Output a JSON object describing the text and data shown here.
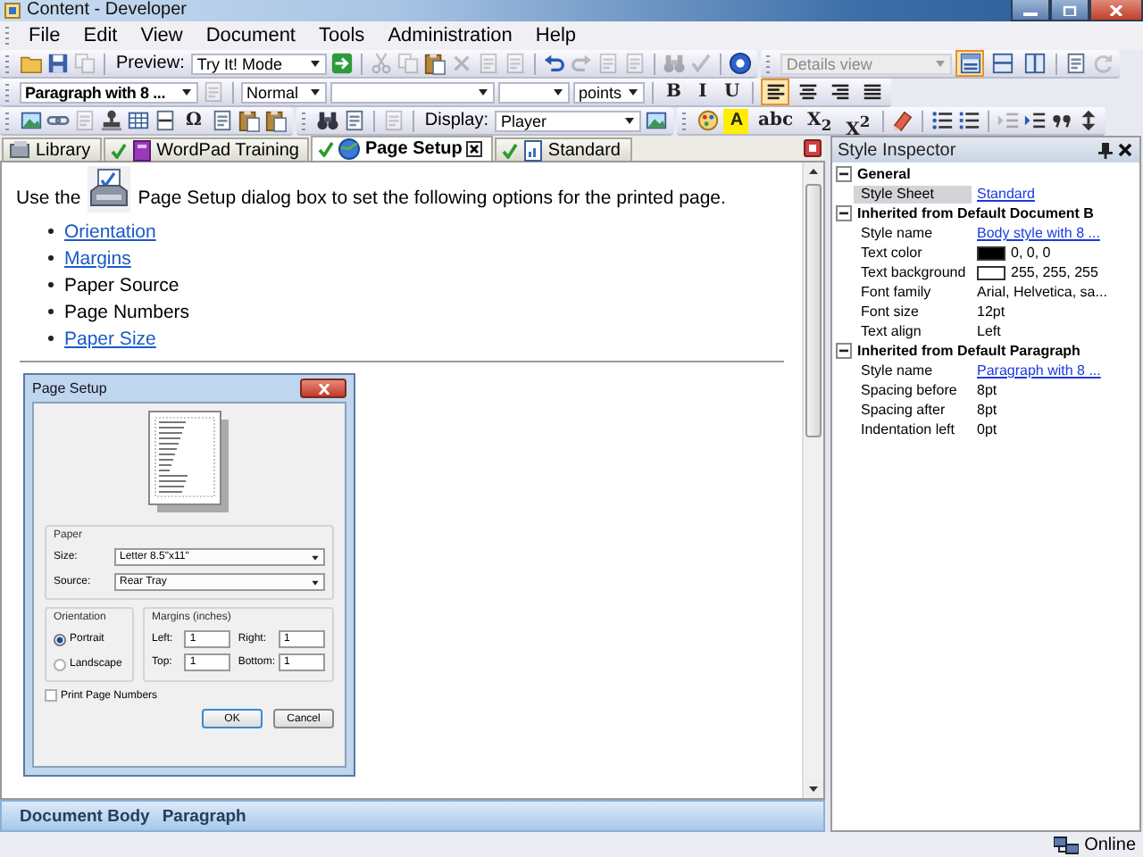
{
  "window": {
    "title": "Content - Developer"
  },
  "menu": [
    "File",
    "Edit",
    "View",
    "Document",
    "Tools",
    "Administration",
    "Help"
  ],
  "toolbars": [
    {
      "bands": [
        {
          "items": [
            {
              "kind": "icon",
              "disabled": false
            },
            {
              "kind": "icon",
              "disabled": false
            },
            {
              "kind": "icon",
              "disabled": true
            },
            {
              "kind": "separator"
            },
            {
              "kind": "label",
              "text": "Preview:"
            },
            {
              "kind": "dropdown",
              "value": "Try It! Mode",
              "disabled": false
            },
            {
              "kind": "icon",
              "disabled": false
            },
            {
              "kind": "separator"
            },
            {
              "kind": "icon",
              "disabled": true
            },
            {
              "kind": "icon",
              "disabled": true
            },
            {
              "kind": "icon",
              "disabled": false
            },
            {
              "kind": "icon",
              "disabled": true
            },
            {
              "kind": "icon",
              "disabled": true
            },
            {
              "kind": "icon",
              "disabled": true
            },
            {
              "kind": "separator"
            },
            {
              "kind": "icon",
              "disabled": false
            },
            {
              "kind": "icon",
              "disabled": true
            },
            {
              "kind": "icon",
              "disabled": true
            },
            {
              "kind": "icon",
              "disabled": true
            },
            {
              "kind": "separator"
            },
            {
              "kind": "icon",
              "disabled": true
            },
            {
              "kind": "icon",
              "disabled": true
            },
            {
              "kind": "separator"
            },
            {
              "kind": "icon",
              "disabled": false
            }
          ]
        },
        {
          "items": [
            {
              "kind": "dropdown",
              "value": "Details view",
              "disabled": true
            },
            {
              "kind": "toggle",
              "selected": true
            },
            {
              "kind": "toggle",
              "selected": false
            },
            {
              "kind": "toggle",
              "selected": false
            },
            {
              "kind": "separator"
            },
            {
              "kind": "icon",
              "disabled": false
            },
            {
              "kind": "icon",
              "disabled": true
            }
          ]
        }
      ]
    },
    {
      "bands": [
        {
          "items": [
            {
              "kind": "dropdown",
              "value": "Paragraph with 8 ...",
              "disabled": false
            },
            {
              "kind": "icon",
              "disabled": true
            },
            {
              "kind": "separator"
            },
            {
              "kind": "dropdown",
              "value": "Normal",
              "disabled": false
            },
            {
              "kind": "dropdown",
              "disabled": false
            },
            {
              "kind": "dropdown",
              "disabled": false
            },
            {
              "kind": "dropdown",
              "value": "points",
              "disabled": false
            },
            {
              "kind": "separator"
            },
            {
              "kind": "text-button",
              "text": "B",
              "selected": false
            },
            {
              "kind": "text-button",
              "text": "I",
              "selected": false
            },
            {
              "kind": "text-button",
              "text": "U",
              "selected": false
            },
            {
              "kind": "separator"
            },
            {
              "kind": "toggle",
              "selected": true
            },
            {
              "kind": "toggle",
              "selected": false
            },
            {
              "kind": "toggle",
              "selected": false
            },
            {
              "kind": "toggle",
              "selected": false
            }
          ]
        }
      ]
    },
    {
      "bands": [
        {
          "items": [
            {
              "kind": "icon",
              "disabled": false
            },
            {
              "kind": "icon",
              "disabled": false
            },
            {
              "kind": "icon",
              "disabled": true
            },
            {
              "kind": "icon",
              "disabled": false
            },
            {
              "kind": "icon",
              "disabled": false
            },
            {
              "kind": "icon",
              "disabled": false
            },
            {
              "kind": "text-button",
              "text": "Ω",
              "selected": false
            },
            {
              "kind": "icon",
              "disabled": false
            },
            {
              "kind": "icon",
              "disabled": false
            },
            {
              "kind": "icon",
              "disabled": false
            }
          ]
        },
        {
          "items": [
            {
              "kind": "icon",
              "disabled": false
            },
            {
              "kind": "icon",
              "disabled": false
            },
            {
              "kind": "separator"
            },
            {
              "kind": "icon",
              "disabled": true
            },
            {
              "kind": "separator"
            },
            {
              "kind": "label",
              "text": "Display:"
            },
            {
              "kind": "dropdown",
              "value": "Player",
              "disabled": false
            },
            {
              "kind": "icon",
              "disabled": false
            }
          ]
        },
        {
          "items": [
            {
              "kind": "icon",
              "disabled": false
            },
            {
              "kind": "highlight",
              "text": "A"
            },
            {
              "kind": "text-button",
              "text": "abc",
              "selected": false
            },
            {
              "kind": "text-button",
              "text": "X$_{2}$",
              "selected": false
            },
            {
              "kind": "text-button",
              "text": "X$^{2}$",
              "selected": false
            },
            {
              "kind": "separator"
            },
            {
              "kind": "icon",
              "disabled": false
            },
            {
              "kind": "separator"
            },
            {
              "kind": "icon",
              "disabled": false
            },
            {
              "kind": "icon",
              "disabled": false
            },
            {
              "kind": "separator"
            },
            {
              "kind": "icon",
              "disabled": true
            },
            {
              "kind": "icon",
              "disabled": false
            },
            {
              "kind": "icon",
              "disabled": false
            },
            {
              "kind": "icon",
              "disabled": false
            }
          ]
        }
      ]
    }
  ],
  "tabs": [
    {
      "label": "Library",
      "selected": false,
      "checked": false
    },
    {
      "label": "WordPad Training",
      "selected": false,
      "checked": true
    },
    {
      "label": "Page Setup",
      "selected": true,
      "checked": true
    },
    {
      "label": "Standard",
      "selected": false,
      "checked": true
    }
  ],
  "document": {
    "intro_before": "Use the",
    "intro_after": "Page Setup dialog box to set the following options for the printed page.",
    "items": [
      {
        "text": "Orientation",
        "kind": "link"
      },
      {
        "text": "Margins",
        "kind": "link"
      },
      {
        "text": "Paper Source",
        "kind": "text"
      },
      {
        "text": "Page Numbers",
        "kind": "text"
      },
      {
        "text": "Paper Size",
        "kind": "link"
      }
    ],
    "dialog": {
      "title": "Page Setup",
      "paper": {
        "label": "Paper",
        "fields": [
          {
            "label": "Size:",
            "value": "Letter 8.5\"x11\""
          },
          {
            "label": "Source:",
            "value": "Rear Tray"
          }
        ]
      },
      "orientation": {
        "label": "Orientation",
        "options": [
          {
            "label": "Portrait",
            "selected": true
          },
          {
            "label": "Landscape",
            "selected": false
          }
        ]
      },
      "margins": {
        "label": "Margins (inches)",
        "fields": [
          {
            "label": "Left:",
            "value": "1"
          },
          {
            "label": "Right:",
            "value": "1"
          },
          {
            "label": "Top:",
            "value": "1"
          },
          {
            "label": "Bottom:",
            "value": "1"
          }
        ]
      },
      "checkbox": {
        "label": "Print Page Numbers",
        "checked": false
      },
      "buttons": [
        "OK",
        "Cancel"
      ]
    }
  },
  "breadcrumb": [
    "Document Body",
    "Paragraph"
  ],
  "style_inspector": {
    "title": "Style Inspector",
    "sections": [
      {
        "title": "General",
        "expanded": true,
        "properties": [
          {
            "name": "Style Sheet",
            "value": "Standard",
            "kind": "link",
            "selected": true
          }
        ]
      },
      {
        "title": "Inherited from Default Document B",
        "expanded": true,
        "properties": [
          {
            "name": "Style name",
            "value": "Body style with 8 ...",
            "kind": "link",
            "selected": false
          },
          {
            "name": "Text color",
            "value": "0, 0, 0",
            "kind": "color",
            "color": "#000000",
            "selected": false
          },
          {
            "name": "Text background",
            "value": "255, 255, 255",
            "kind": "color",
            "color": "#ffffff",
            "selected": false
          },
          {
            "name": "Font family",
            "value": "Arial, Helvetica, sa...",
            "kind": "text",
            "selected": false
          },
          {
            "name": "Font size",
            "value": "12pt",
            "kind": "text",
            "selected": false
          },
          {
            "name": "Text align",
            "value": "Left",
            "kind": "text",
            "selected": false
          }
        ]
      },
      {
        "title": "Inherited from Default Paragraph",
        "expanded": true,
        "properties": [
          {
            "name": "Style name",
            "value": "Paragraph with 8 ...",
            "kind": "link",
            "selected": false
          },
          {
            "name": "Spacing before",
            "value": "8pt",
            "kind": "text",
            "selected": false
          },
          {
            "name": "Spacing after",
            "value": "8pt",
            "kind": "text",
            "selected": false
          },
          {
            "name": "Indentation left",
            "value": "0pt",
            "kind": "text",
            "selected": false
          }
        ]
      }
    ]
  },
  "status_bar": {
    "text": "Online"
  }
}
